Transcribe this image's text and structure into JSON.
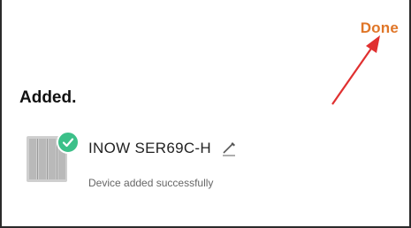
{
  "header": {
    "done_label": "Done",
    "done_color": "#e07628"
  },
  "heading": "Added.",
  "device": {
    "name": "INOW SER69C-H",
    "status": "Device added successfully",
    "thumbnail": "radiator-icon",
    "badge": "check-icon",
    "badge_color": "#3cc089",
    "edit": "pencil-icon"
  },
  "annotation": {
    "arrow_color": "#e03030"
  }
}
